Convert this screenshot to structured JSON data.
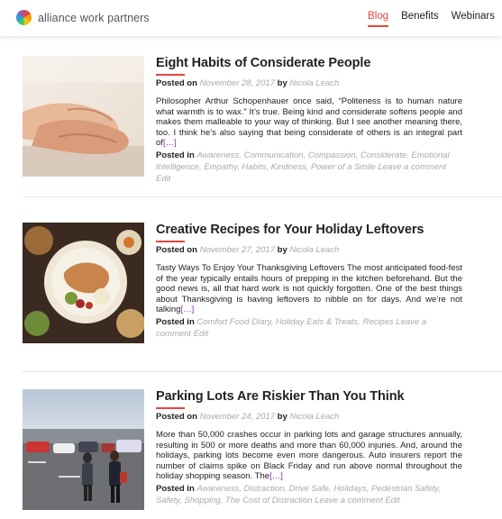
{
  "site": {
    "name": "alliance work partners"
  },
  "nav": [
    {
      "label": "Blog",
      "active": true
    },
    {
      "label": "Benefits",
      "active": false
    },
    {
      "label": "Webinars",
      "active": false
    }
  ],
  "posts": [
    {
      "title": "Eight Habits of Considerate People",
      "posted_on_label": "Posted on",
      "date": "November 28, 2017",
      "by_label": "by",
      "author": "Nicola Leach",
      "excerpt": "Philosopher Arthur Schopenhauer once said, “Politeness is to human nature what warmth is to wax.” It’s true. Being kind and considerate softens people and makes them malleable to your way of thinking.  But I see another meaning there, too. I think he’s also saying that being considerate of others is an integral part of",
      "more": "[…]",
      "posted_in_label": "Posted in",
      "categories": [
        "Awareness",
        "Communication",
        "Compassion",
        "Considerate",
        "Emotional Intelligence",
        "Empathy",
        "Habits",
        "Kindness",
        "Power of a Smile"
      ],
      "comment_label": "Leave a comment",
      "edit_label": "Edit"
    },
    {
      "title": "Creative Recipes for Your Holiday Leftovers",
      "posted_on_label": "Posted on",
      "date": "November 27, 2017",
      "by_label": "by",
      "author": "Nicola Leach",
      "excerpt": "Tasty Ways To Enjoy Your Thanksgiving Leftovers  The most anticipated food-fest of the year typically entails hours of prepping in the kitchen beforehand. But the good news is, all that hard work is not quickly forgotten. One of the best things about Thanksgiving is having leftovers to nibble on for days. And we’re not talking",
      "more": "[…]",
      "posted_in_label": "Posted in",
      "categories": [
        "Comfort Food Diary",
        "Holiday Eats & Treats",
        "Recipes"
      ],
      "comment_label": "Leave a comment",
      "edit_label": "Edit"
    },
    {
      "title": "Parking Lots Are Riskier Than You Think",
      "posted_on_label": "Posted on",
      "date": "November 24, 2017",
      "by_label": "by",
      "author": "Nicola Leach",
      "excerpt": "More than 50,000 crashes occur in parking lots and garage structures annually, resulting in 500 or more deaths and more than 60,000 injuries. And, around the holidays, parking lots become even more dangerous. Auto insurers report the number of claims spike on Black Friday and run above normal throughout the holiday shopping season. The",
      "more": "[…]",
      "posted_in_label": "Posted in",
      "categories": [
        "Awareness",
        "Distraction",
        "Drive Safe",
        "Holidays",
        "Pedestrian Safety",
        "Safety",
        "Shopping",
        "The Cost of Distraction"
      ],
      "comment_label": "Leave a comment",
      "edit_label": "Edit"
    }
  ],
  "colors": {
    "accent": "#e8453c",
    "meta_gray": "#aaaaaa",
    "more_link": "#8b2bb5"
  }
}
